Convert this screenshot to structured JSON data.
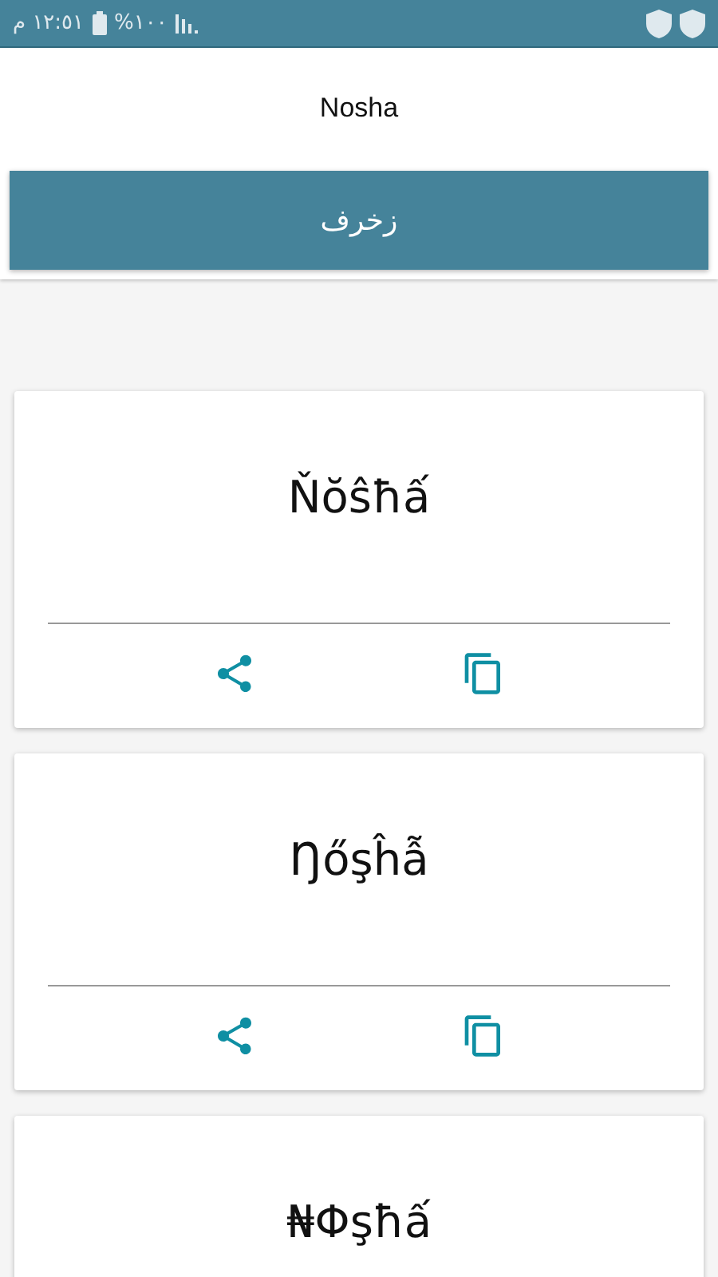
{
  "status_bar": {
    "time": "١٢:٥١ م",
    "battery": "%١٠٠"
  },
  "input": {
    "value": "Nosha"
  },
  "decorate_button": {
    "label": "زخرف"
  },
  "results": [
    {
      "text": "Ňŏŝħấ",
      "actions": [
        {
          "kind": "share"
        },
        {
          "kind": "copy"
        }
      ]
    },
    {
      "text": "Ŋőşĥẫ",
      "actions": [
        {
          "kind": "share"
        },
        {
          "kind": "copy"
        }
      ]
    },
    {
      "text": "₦Φşħấ"
    }
  ]
}
